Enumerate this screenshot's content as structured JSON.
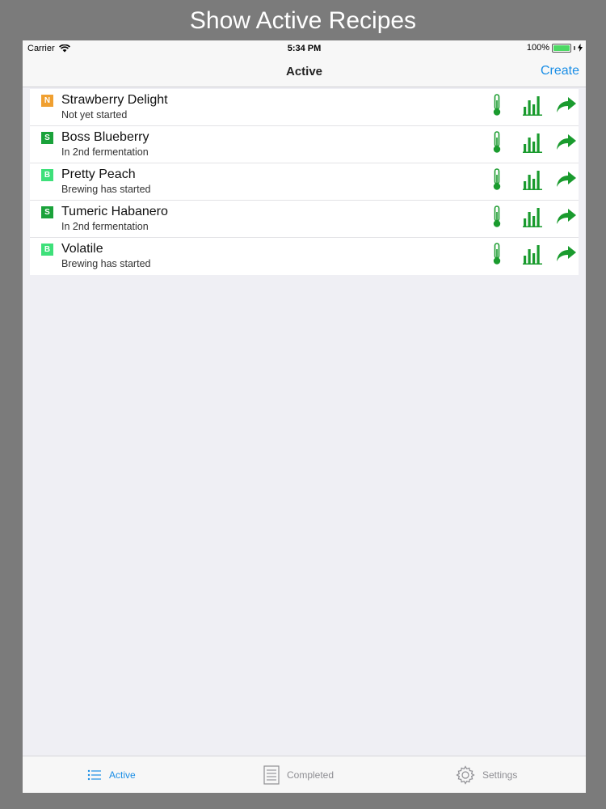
{
  "caption": "Show Active Recipes",
  "status_bar": {
    "carrier": "Carrier",
    "time": "5:34 PM",
    "battery": "100%"
  },
  "nav": {
    "title": "Active",
    "create_label": "Create"
  },
  "recipes": [
    {
      "badge": "N",
      "badge_color": "#f0a030",
      "name": "Strawberry Delight",
      "status": "Not yet started"
    },
    {
      "badge": "S",
      "badge_color": "#1aa23a",
      "name": "Boss Blueberry",
      "status": "In 2nd fermentation"
    },
    {
      "badge": "B",
      "badge_color": "#3ee07a",
      "name": "Pretty Peach",
      "status": "Brewing has started"
    },
    {
      "badge": "S",
      "badge_color": "#1aa23a",
      "name": "Tumeric Habanero",
      "status": "In 2nd fermentation"
    },
    {
      "badge": "B",
      "badge_color": "#3ee07a",
      "name": "Volatile",
      "status": "Brewing has started"
    }
  ],
  "row_icons": [
    "thermometer-icon",
    "bar-chart-icon",
    "share-arrow-icon"
  ],
  "tabs": {
    "active": "Active",
    "completed": "Completed",
    "settings": "Settings"
  },
  "colors": {
    "accent": "#1a8ee6",
    "icon_green": "#1a9b2e",
    "inactive_tab": "#8e8e93"
  }
}
